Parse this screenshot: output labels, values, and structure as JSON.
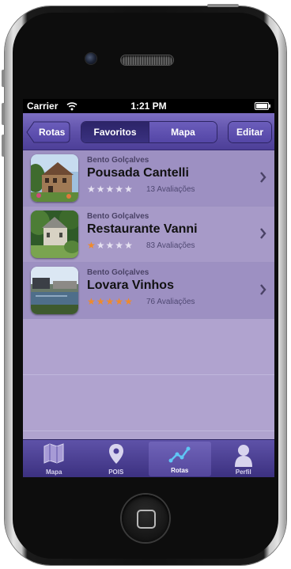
{
  "status": {
    "carrier": "Carrier",
    "time": "1:21 PM"
  },
  "nav": {
    "back_label": "Rotas",
    "segments": [
      "Favoritos",
      "Mapa"
    ],
    "edit_label": "Editar"
  },
  "items": [
    {
      "city": "Bento Golçalves",
      "name": "Pousada Cantelli",
      "rating": 0,
      "reviews": "13 Avaliações"
    },
    {
      "city": "Bento Golçalves",
      "name": "Restaurante Vanni",
      "rating": 1,
      "reviews": "83 Avaliações"
    },
    {
      "city": "Bento Golçalves",
      "name": "Lovara Vinhos",
      "rating": 5,
      "reviews": "76 Avaliações"
    }
  ],
  "tabs": [
    {
      "label": "Mapa",
      "icon": "map-icon"
    },
    {
      "label": "POIS",
      "icon": "pin-icon"
    },
    {
      "label": "Rotas",
      "icon": "route-icon"
    },
    {
      "label": "Perfil",
      "icon": "person-icon"
    }
  ],
  "colors": {
    "accent": "#5d4fa8",
    "list_bg": "#b0a3cf",
    "star": "#f08a2a"
  }
}
